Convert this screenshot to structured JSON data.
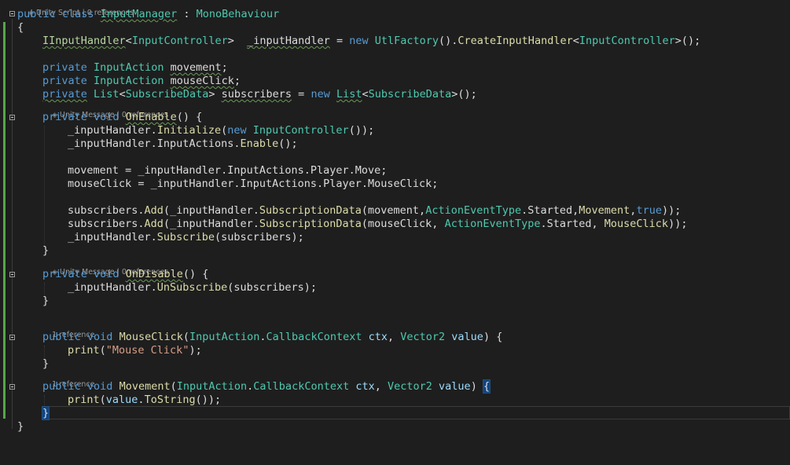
{
  "editor": {
    "language": "C#",
    "theme": "dark",
    "colors": {
      "background": "#1e1e1e",
      "keyword": "#569cd6",
      "type": "#4ec9b0",
      "interface": "#b8d7a3",
      "method": "#dcdcaa",
      "string": "#d69d85",
      "parameter": "#9cdcfe",
      "text": "#dcdcdc",
      "codelens": "#999999",
      "change_bar": "#57a64a"
    }
  },
  "codelens": {
    "class_header": "Unity Script | 0 references",
    "on_enable": "Unity Message | 0 references",
    "on_disable": "Unity Message | 0 references",
    "mouse_click": "1 reference",
    "movement": "1 reference"
  },
  "code": {
    "class_decl": {
      "kw1": "public",
      "kw2": "class",
      "name": "InputManager",
      "sep": " : ",
      "base": "MonoBehaviour"
    },
    "open_brace": "{",
    "field_handler": {
      "iface": "IInputHandler",
      "lt": "<",
      "arg": "InputController",
      "gt": ">",
      "sp": "  ",
      "name": "_inputHandler",
      "eq": " = ",
      "kw": "new",
      "factory": "UtlFactory",
      "call1": "().",
      "method": "CreateInputHandler",
      "lt2": "<",
      "arg2": "InputController",
      "end": ">();"
    },
    "field_movement": {
      "kw": "private",
      "type": "InputAction",
      "name": "movement",
      "end": ";"
    },
    "field_mouseclick": {
      "kw": "private",
      "type": "InputAction",
      "name": "mouseClick",
      "end": ";"
    },
    "field_subscribers": {
      "kw": "private",
      "type": "List",
      "lt": "<",
      "arg": "SubscribeData",
      "gt": "> ",
      "name": "subscribers",
      "eq": " = ",
      "kw2": "new",
      "type2": "List",
      "lt2": "<",
      "arg2": "SubscribeData",
      "end": ">();"
    },
    "on_enable_decl": {
      "kw1": "private",
      "kw2": "void",
      "name": "OnEnable",
      "end": "() {"
    },
    "oe_line1": {
      "obj": "_inputHandler",
      "dot": ".",
      "method": "Initialize",
      "open": "(",
      "kw": "new",
      "type": "InputController",
      "end": "());"
    },
    "oe_line2": {
      "obj": "_inputHandler",
      "dot": ".InputActions.",
      "method": "Enable",
      "end": "();"
    },
    "oe_line3": "movement = _inputHandler.InputActions.Player.Move;",
    "oe_line4": "mouseClick = _inputHandler.InputActions.Player.MouseClick;",
    "oe_line5": {
      "obj": "subscribers.",
      "method": "Add",
      "open": "(_inputHandler.",
      "method2": "SubscriptionData",
      "args1": "(movement,",
      "type": "ActionEventType",
      "args2": ".Started,",
      "cb": "Movement",
      "comma": ",",
      "kw": "true",
      "end": "));"
    },
    "oe_line6": {
      "obj": "subscribers.",
      "method": "Add",
      "open": "(_inputHandler.",
      "method2": "SubscriptionData",
      "args1": "(mouseClick, ",
      "type": "ActionEventType",
      "args2": ".Started, ",
      "cb": "MouseClick",
      "end": "));"
    },
    "oe_line7": {
      "obj": "_inputHandler.",
      "method": "Subscribe",
      "end": "(subscribers);"
    },
    "close_brace": "}",
    "on_disable_decl": {
      "kw1": "private",
      "kw2": "void",
      "name": "OnDisable",
      "end": "() {"
    },
    "od_line1": {
      "obj": "_inputHandler.",
      "method": "UnSubscribe",
      "end": "(subscribers);"
    },
    "mouse_click_decl": {
      "kw1": "public",
      "kw2": "void",
      "name": "MouseClick",
      "open": "(",
      "type": "InputAction",
      "dot": ".",
      "type2": "CallbackContext",
      "p1": " ctx",
      "comma": ", ",
      "type3": "Vector2",
      "p2": " value",
      "end": ") {"
    },
    "mc_line1": {
      "method": "print",
      "open": "(",
      "str": "\"Mouse Click\"",
      "end": ");"
    },
    "movement_decl": {
      "kw1": "public",
      "kw2": "void",
      "name": "Movement",
      "open": "(",
      "type": "InputAction",
      "dot": ".",
      "type2": "CallbackContext",
      "p1": " ctx",
      "comma": ", ",
      "type3": "Vector2",
      "p2": " value",
      "close": ") ",
      "brace": "{"
    },
    "mv_line1": {
      "method": "print",
      "open": "(",
      "p": "value",
      "dot": ".",
      "method2": "ToString",
      "end": "());"
    },
    "mv_close": "}",
    "final_close": "}"
  }
}
